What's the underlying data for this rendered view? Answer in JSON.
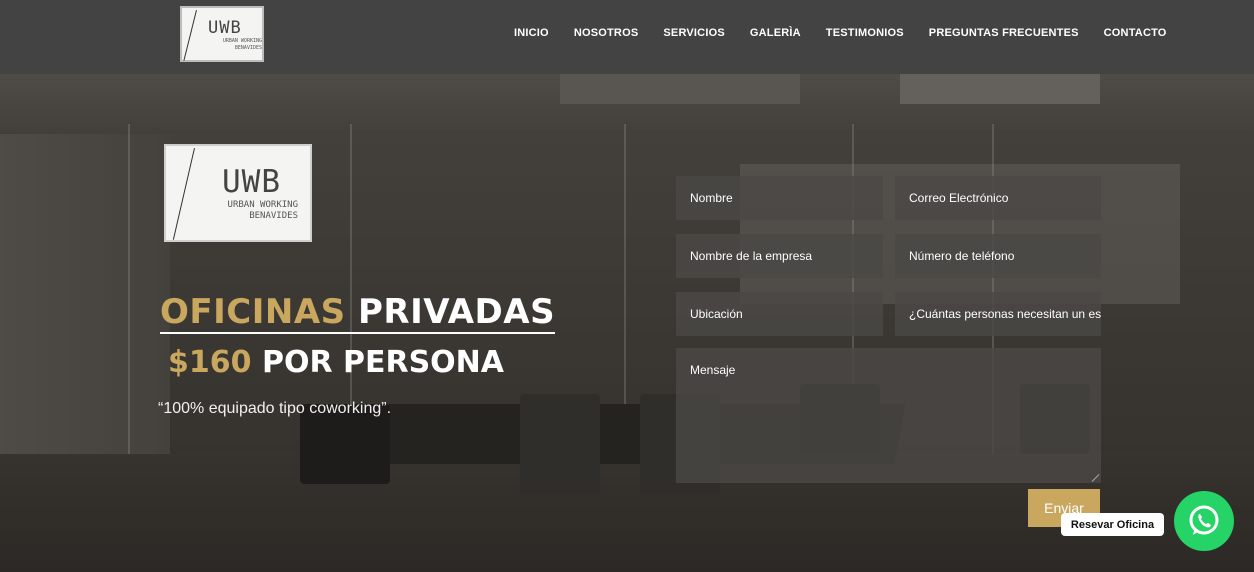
{
  "brand": {
    "logo_letters": "UWB",
    "logo_sub_line1": "URBAN WORKING",
    "logo_sub_line2": "BENAVIDES"
  },
  "nav": {
    "items": [
      "INICIO",
      "NOSOTROS",
      "SERVICIOS",
      "GALERÌA",
      "TESTIMONIOS",
      "PREGUNTAS FRECUENTES",
      "CONTACTO"
    ]
  },
  "hero": {
    "headline_gold": "OFICINAS",
    "headline_white": "PRIVADAS",
    "price_gold": "$160",
    "price_white": "POR PERSONA",
    "tagline": "“100% equipado tipo coworking”."
  },
  "form": {
    "name_placeholder": "Nombre",
    "email_placeholder": "Correo Electrónico",
    "company_placeholder": "Nombre de la empresa",
    "phone_placeholder": "Número de teléfono",
    "location_placeholder": "Ubicación",
    "people_placeholder": "¿Cuántas personas necesitan un espacio?",
    "message_placeholder": "Mensaje",
    "submit_label": "Enviar"
  },
  "whatsapp": {
    "label": "Resevar Oficina"
  },
  "colors": {
    "header_bg": "#434343",
    "accent_gold": "#c9a75e",
    "whatsapp_green": "#25d366"
  }
}
